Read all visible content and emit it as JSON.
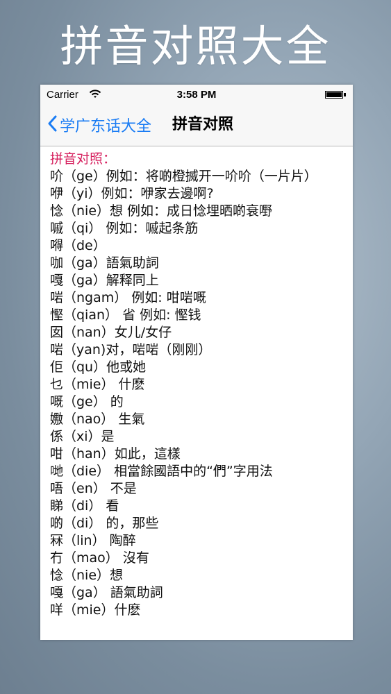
{
  "banner": {
    "title": "拼音对照大全"
  },
  "status_bar": {
    "carrier": "Carrier",
    "time": "3:58 PM"
  },
  "nav": {
    "back_label": "学广东话大全",
    "title": "拼音对照"
  },
  "content": {
    "header": "拼音对照：",
    "rows": [
      "吤（ge）例如：将啲橙搣开一吤吤（一片片）",
      "咿（yi）例如：咿家去邊啊?",
      "惗（nie）想 例如：成日惗埋晒啲衰嘢",
      "嘁（qi） 例如：嘁起条筋",
      "嘚（de）",
      "咖（ga）語氣助詞",
      "嘎（ga）解释同上",
      "啱（ngam） 例如: 咁啱嘅",
      "慳（qian） 省 例如: 慳钱",
      "囡（nan）女儿/女仔",
      "啱（yan)对，啱啱（刚刚）",
      "佢（qu）他或她",
      "乜（mie） 什麽",
      "嘅（ge）   的",
      "嫐（nao）   生氣",
      "係（xi）是",
      "咁（han）如此，這樣",
      "哋（die） 相當餘國語中的“們”字用法",
      "唔（en）   不是",
      "睇（di）   看",
      "啲（di）   的，那些",
      "冧（lin）   陶醉",
      "冇（mao）   沒有",
      "惗（nie）想",
      "嘎（ga）   語氣助詞",
      "咩（mie）什麽"
    ]
  },
  "colors": {
    "accent_blue": "#1a7cf4",
    "header_pink": "#d6205e",
    "banner_text": "#ffffff"
  },
  "icons": {
    "wifi": "wifi-icon",
    "battery": "battery-icon",
    "back": "chevron-left-icon"
  }
}
